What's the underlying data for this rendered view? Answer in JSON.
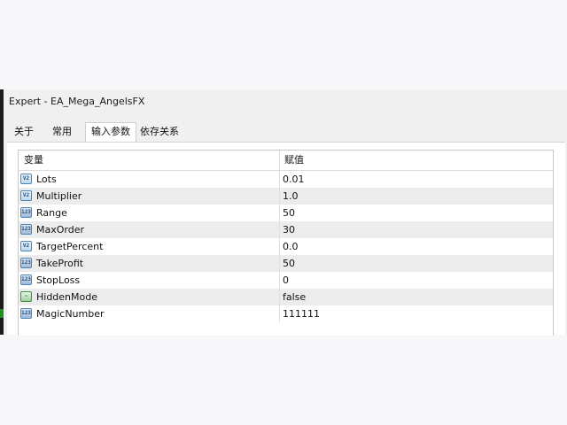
{
  "window": {
    "title": "Expert - EA_Mega_AngelsFX"
  },
  "tabs": [
    {
      "label": "关于",
      "active": false
    },
    {
      "label": "常用",
      "active": false
    },
    {
      "label": "输入参数",
      "active": true
    },
    {
      "label": "依存关系",
      "active": false
    }
  ],
  "table": {
    "headers": {
      "variable": "变量",
      "value": "赋值"
    },
    "rows": [
      {
        "icon": "double-type-icon",
        "name": "Lots",
        "value": "0.01"
      },
      {
        "icon": "double-type-icon",
        "name": "Multiplier",
        "value": "1.0"
      },
      {
        "icon": "integer-type-icon",
        "name": "Range",
        "value": "50"
      },
      {
        "icon": "integer-type-icon",
        "name": "MaxOrder",
        "value": "30"
      },
      {
        "icon": "double-type-icon",
        "name": "TargetPercent",
        "value": "0.0"
      },
      {
        "icon": "integer-type-icon",
        "name": "TakeProfit",
        "value": "50"
      },
      {
        "icon": "integer-type-icon",
        "name": "StopLoss",
        "value": "0"
      },
      {
        "icon": "boolean-type-icon",
        "name": "HiddenMode",
        "value": "false"
      },
      {
        "icon": "integer-type-icon",
        "name": "MagicNumber",
        "value": "111111"
      }
    ]
  }
}
